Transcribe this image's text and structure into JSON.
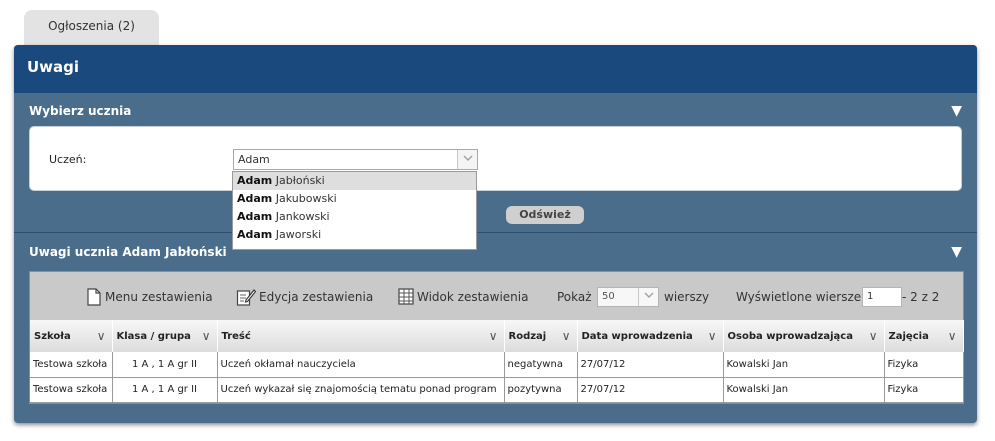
{
  "tab": {
    "label": "Ogłoszenia (2)"
  },
  "panel": {
    "title": "Uwagi"
  },
  "select_section": {
    "title": "Wybierz ucznia",
    "student_label": "Uczeń:",
    "student_value": "Adam",
    "refresh_label": "Odśwież",
    "suggestions": [
      {
        "match": "Adam",
        "rest": " Jabłoński",
        "highlighted": true
      },
      {
        "match": "Adam",
        "rest": " Jakubowski",
        "highlighted": false
      },
      {
        "match": "Adam",
        "rest": " Jankowski",
        "highlighted": false
      },
      {
        "match": "Adam",
        "rest": " Jaworski",
        "highlighted": false
      }
    ]
  },
  "notes_section": {
    "title": "Uwagi ucznia Adam Jabłoński",
    "toolbar": {
      "menu_label": "Menu zestawienia",
      "edit_label": "Edycja zestawienia",
      "view_label": "Widok zestawienia",
      "show_label": "Pokaż",
      "show_value": "50",
      "rows_label": "wierszy",
      "displayed_label": "Wyświetlone wiersze",
      "displayed_from": "1",
      "displayed_range": "- 2 z 2"
    },
    "columns": [
      "Szkoła",
      "Klasa / grupa",
      "Treść",
      "Rodzaj",
      "Data wprowadzenia",
      "Osoba wprowadzająca",
      "Zajęcia"
    ],
    "rows": [
      [
        "Testowa szkoła",
        "1 A , 1 A gr II",
        "Uczeń okłamał nauczyciela",
        "negatywna",
        "27/07/12",
        "Kowalski Jan",
        "Fizyka"
      ],
      [
        "Testowa szkoła",
        "1 A , 1 A gr II",
        "Uczeń wykazał się znajomością tematu ponad program",
        "pozytywna",
        "27/07/12",
        "Kowalski Jan",
        "Fizyka"
      ]
    ]
  },
  "colors": {
    "header": "#1a4a7d",
    "panel": "#4a6d8c"
  },
  "icons": [
    "collapse-arrow-icon",
    "chevron-down-icon",
    "document-icon",
    "edit-icon",
    "grid-icon"
  ]
}
